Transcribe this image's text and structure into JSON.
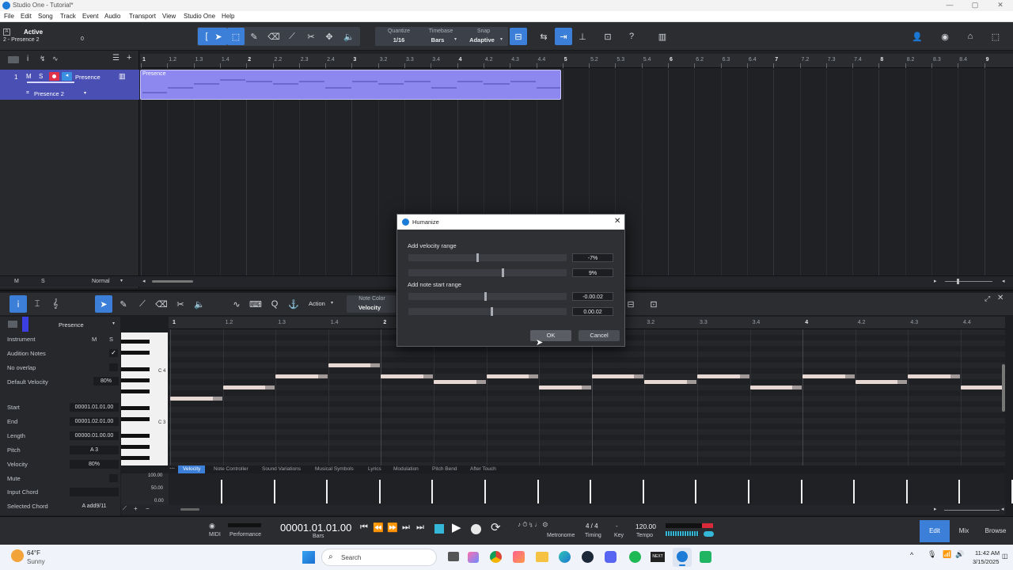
{
  "window": {
    "title": "Studio One - Tutorial*"
  },
  "menu": [
    "File",
    "Edit",
    "Song",
    "Track",
    "Event",
    "Audio",
    "Transport",
    "View",
    "Studio One",
    "Help"
  ],
  "toolbar": {
    "active_label": "Active",
    "active_track": "2 - Presence 2",
    "active_count": "0",
    "quantize_label": "Quantize",
    "quantize_value": "1/16",
    "timebase_label": "Timebase",
    "timebase_value": "Bars",
    "snap_label": "Snap",
    "snap_value": "Adaptive"
  },
  "ruler_top": [
    {
      "t": "1",
      "maj": true
    },
    {
      "t": "1.2"
    },
    {
      "t": "1.3"
    },
    {
      "t": "1.4"
    },
    {
      "t": "2",
      "maj": true
    },
    {
      "t": "2.2"
    },
    {
      "t": "2.3"
    },
    {
      "t": "2.4"
    },
    {
      "t": "3",
      "maj": true
    },
    {
      "t": "3.2"
    },
    {
      "t": "3.3"
    },
    {
      "t": "3.4"
    },
    {
      "t": "4",
      "maj": true
    },
    {
      "t": "4.2"
    },
    {
      "t": "4.3"
    },
    {
      "t": "4.4"
    },
    {
      "t": "5",
      "maj": true
    },
    {
      "t": "5.2"
    },
    {
      "t": "5.3"
    },
    {
      "t": "5.4"
    },
    {
      "t": "6",
      "maj": true
    },
    {
      "t": "6.2"
    },
    {
      "t": "6.3"
    },
    {
      "t": "6.4"
    },
    {
      "t": "7",
      "maj": true
    },
    {
      "t": "7.2"
    },
    {
      "t": "7.3"
    },
    {
      "t": "7.4"
    },
    {
      "t": "8",
      "maj": true
    },
    {
      "t": "8.2"
    },
    {
      "t": "8.3"
    },
    {
      "t": "8.4"
    },
    {
      "t": "9",
      "maj": true
    }
  ],
  "track": {
    "number": "1",
    "m": "M",
    "s": "S",
    "name": "Presence",
    "instrument": "Presence 2",
    "clip_name": "Presence"
  },
  "arrange_footer": {
    "m": "M",
    "s": "S",
    "mode": "Normal"
  },
  "editor": {
    "action_label": "Action",
    "note_color_label": "Note Color",
    "note_color_value": "Velocity",
    "track_name": "Presence",
    "ruler": [
      "1",
      "1.2",
      "1.3",
      "1.4",
      "2",
      "2.2",
      "2.3",
      "2.4",
      "3",
      "3.2",
      "3.3",
      "3.4",
      "4",
      "4.2",
      "4.3",
      "4.4"
    ]
  },
  "inspector": {
    "instrument_label": "Instrument",
    "m": "M",
    "s": "S",
    "audition_notes": "Audition Notes",
    "no_overlap": "No overlap",
    "default_velocity_label": "Default Velocity",
    "default_velocity": "80%",
    "start_label": "Start",
    "start": "00001.01.01.00",
    "end_label": "End",
    "end": "00001.02.01.00",
    "length_label": "Length",
    "length": "00000.01.00.00",
    "pitch_label": "Pitch",
    "pitch": "A 3",
    "velocity_label": "Velocity",
    "velocity": "80%",
    "mute_label": "Mute",
    "input_chord_label": "Input Chord",
    "selected_chord_label": "Selected Chord",
    "selected_chord": "A add9/11",
    "c4": "C 4",
    "c3": "C 3"
  },
  "lanes": [
    "Velocity",
    "Note Controller",
    "Sound Variations",
    "Musical Symbols",
    "Lyrics",
    "Modulation",
    "Pitch Bend",
    "After Touch"
  ],
  "lane_scale": [
    "100.00",
    "50.00",
    "0.00"
  ],
  "dialog": {
    "title": "Humanize",
    "velocity_label": "Add velocity range",
    "vel_min": "-7%",
    "vel_max": "9%",
    "vel_min_frac": 0.43,
    "vel_max_frac": 0.59,
    "start_label": "Add note start range",
    "start_min": "-0.00.02",
    "start_max": "0.00.02",
    "start_min_frac": 0.48,
    "start_max_frac": 0.52,
    "ok": "OK",
    "cancel": "Cancel"
  },
  "transport": {
    "midi": "MIDI",
    "performance": "Performance",
    "time": "00001.01.01.00",
    "time_unit": "Bars",
    "metronome": "Metronome",
    "timing": "Timing",
    "timesig": "4 / 4",
    "key": "Key",
    "tempo_label": "Tempo",
    "tempo": "120.00",
    "edit": "Edit",
    "mix": "Mix",
    "browse": "Browse"
  },
  "taskbar": {
    "weather_temp": "64°F",
    "weather_desc": "Sunny",
    "search": "Search",
    "time": "11:42 AM",
    "date": "3/15/2025"
  }
}
